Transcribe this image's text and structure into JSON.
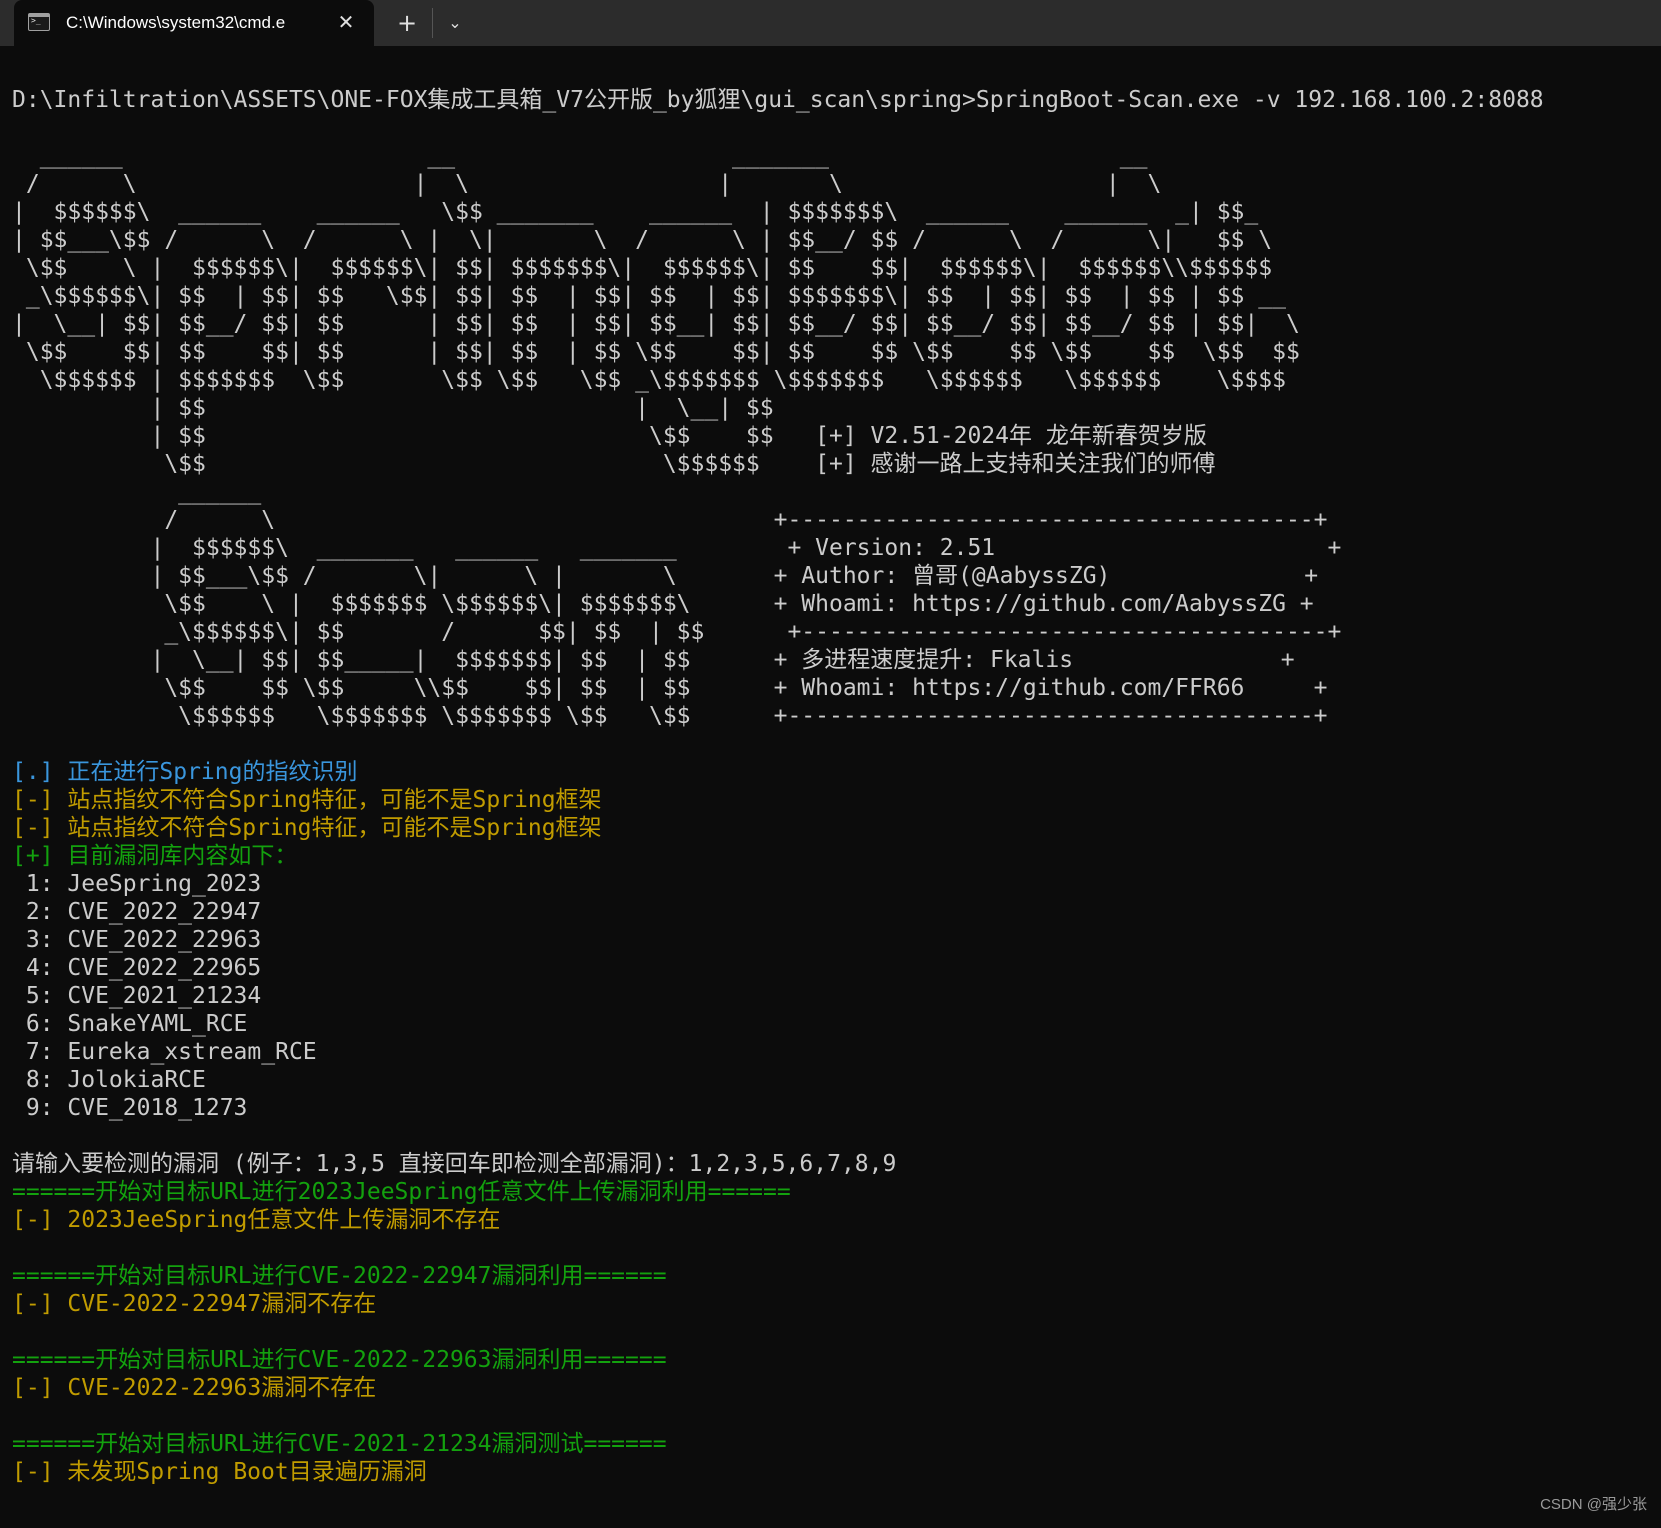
{
  "window": {
    "tab_title": "C:\\Windows\\system32\\cmd.e",
    "close_glyph": "✕",
    "new_tab_glyph": "+",
    "dropdown_glyph": "⌄"
  },
  "colors": {
    "background": "#0c0c0c",
    "default_text": "#cccccc",
    "info": "#3a96dd",
    "warning": "#c19c00",
    "success": "#13a10e"
  },
  "console": {
    "lines": [
      {
        "text": "D:\\Infiltration\\ASSETS\\ONE-FOX集成工具箱_V7公开版_by狐狸\\gui_scan\\spring>SpringBoot-Scan.exe -v 192.168.100.2:8088",
        "style": "default"
      },
      {
        "text": "",
        "style": "default"
      },
      {
        "text": "  ______                      __                    _______                     __",
        "style": "default"
      },
      {
        "text": " /      \\                    |  \\                  |       \\                   |  \\",
        "style": "default"
      },
      {
        "text": "|  $$$$$$\\  ______    ______   \\$$ _______    ______  | $$$$$$$\\  ______    ______  _| $$_",
        "style": "default"
      },
      {
        "text": "| $$___\\$$ /      \\  /      \\ |  \\|       \\  /      \\ | $$__/ $$ /      \\  /      \\|   $$ \\",
        "style": "default"
      },
      {
        "text": " \\$$    \\ |  $$$$$$\\|  $$$$$$\\| $$| $$$$$$$\\|  $$$$$$\\| $$    $$|  $$$$$$\\|  $$$$$$\\\\$$$$$$",
        "style": "default"
      },
      {
        "text": " _\\$$$$$$\\| $$  | $$| $$   \\$$| $$| $$  | $$| $$  | $$| $$$$$$$\\| $$  | $$| $$  | $$ | $$ __",
        "style": "default"
      },
      {
        "text": "|  \\__| $$| $$__/ $$| $$      | $$| $$  | $$| $$__| $$| $$__/ $$| $$__/ $$| $$__/ $$ | $$|  \\",
        "style": "default"
      },
      {
        "text": " \\$$    $$| $$    $$| $$      | $$| $$  | $$ \\$$    $$| $$    $$ \\$$    $$ \\$$    $$  \\$$  $$",
        "style": "default"
      },
      {
        "text": "  \\$$$$$$ | $$$$$$$  \\$$       \\$$ \\$$   \\$$ _\\$$$$$$$ \\$$$$$$$   \\$$$$$$   \\$$$$$$    \\$$$$",
        "style": "default"
      },
      {
        "text": "          | $$                               |  \\__| $$",
        "style": "default"
      },
      {
        "text": "          | $$                                \\$$    $$   [+] V2.51-2024年 龙年新春贺岁版",
        "style": "default"
      },
      {
        "text": "           \\$$                                 \\$$$$$$    [+] 感谢一路上支持和关注我们的师傅",
        "style": "default"
      },
      {
        "text": "            ______",
        "style": "default"
      },
      {
        "text": "           /      \\                                    +--------------------------------------+",
        "style": "default"
      },
      {
        "text": "          |  $$$$$$\\  _______   ______   _______        + Version: 2.51                        +",
        "style": "default"
      },
      {
        "text": "          | $$___\\$$ /       \\|      \\ |       \\       + Author: 曾哥(@AabyssZG)              +",
        "style": "default"
      },
      {
        "text": "           \\$$    \\ |  $$$$$$$ \\$$$$$$\\| $$$$$$$\\      + Whoami: https://github.com/AabyssZG +",
        "style": "default"
      },
      {
        "text": "           _\\$$$$$$\\| $$       /      $$| $$  | $$      +--------------------------------------+",
        "style": "default"
      },
      {
        "text": "          |  \\__| $$| $$_____|  $$$$$$$| $$  | $$      + 多进程速度提升: Fkalis               +",
        "style": "default"
      },
      {
        "text": "           \\$$    $$ \\$$     \\\\$$    $$| $$  | $$      + Whoami: https://github.com/FFR66     +",
        "style": "default"
      },
      {
        "text": "            \\$$$$$$   \\$$$$$$$ \\$$$$$$$ \\$$   \\$$      +--------------------------------------+",
        "style": "default"
      },
      {
        "text": "",
        "style": "default"
      },
      {
        "text": "[.] 正在进行Spring的指纹识别",
        "style": "info"
      },
      {
        "text": "[-] 站点指纹不符合Spring特征，可能不是Spring框架",
        "style": "warning"
      },
      {
        "text": "[-] 站点指纹不符合Spring特征，可能不是Spring框架",
        "style": "warning"
      },
      {
        "text": "[+] 目前漏洞库内容如下：",
        "style": "success"
      },
      {
        "text": " 1: JeeSpring_2023",
        "style": "default"
      },
      {
        "text": " 2: CVE_2022_22947",
        "style": "default"
      },
      {
        "text": " 3: CVE_2022_22963",
        "style": "default"
      },
      {
        "text": " 4: CVE_2022_22965",
        "style": "default"
      },
      {
        "text": " 5: CVE_2021_21234",
        "style": "default"
      },
      {
        "text": " 6: SnakeYAML_RCE",
        "style": "default"
      },
      {
        "text": " 7: Eureka_xstream_RCE",
        "style": "default"
      },
      {
        "text": " 8: JolokiaRCE",
        "style": "default"
      },
      {
        "text": " 9: CVE_2018_1273",
        "style": "default"
      },
      {
        "text": "",
        "style": "default"
      },
      {
        "text": "请输入要检测的漏洞 (例子：1,3,5 直接回车即检测全部漏洞)：1,2,3,5,6,7,8,9",
        "style": "default"
      },
      {
        "text": "======开始对目标URL进行2023JeeSpring任意文件上传漏洞利用======",
        "style": "success"
      },
      {
        "text": "[-] 2023JeeSpring任意文件上传漏洞不存在",
        "style": "warning"
      },
      {
        "text": "",
        "style": "default"
      },
      {
        "text": "======开始对目标URL进行CVE-2022-22947漏洞利用======",
        "style": "success"
      },
      {
        "text": "[-] CVE-2022-22947漏洞不存在",
        "style": "warning"
      },
      {
        "text": "",
        "style": "default"
      },
      {
        "text": "======开始对目标URL进行CVE-2022-22963漏洞利用======",
        "style": "success"
      },
      {
        "text": "[-] CVE-2022-22963漏洞不存在",
        "style": "warning"
      },
      {
        "text": "",
        "style": "default"
      },
      {
        "text": "======开始对目标URL进行CVE-2021-21234漏洞测试======",
        "style": "success"
      },
      {
        "text": "[-] 未发现Spring Boot目录遍历漏洞",
        "style": "warning"
      }
    ]
  },
  "watermark": "CSDN @强少张"
}
